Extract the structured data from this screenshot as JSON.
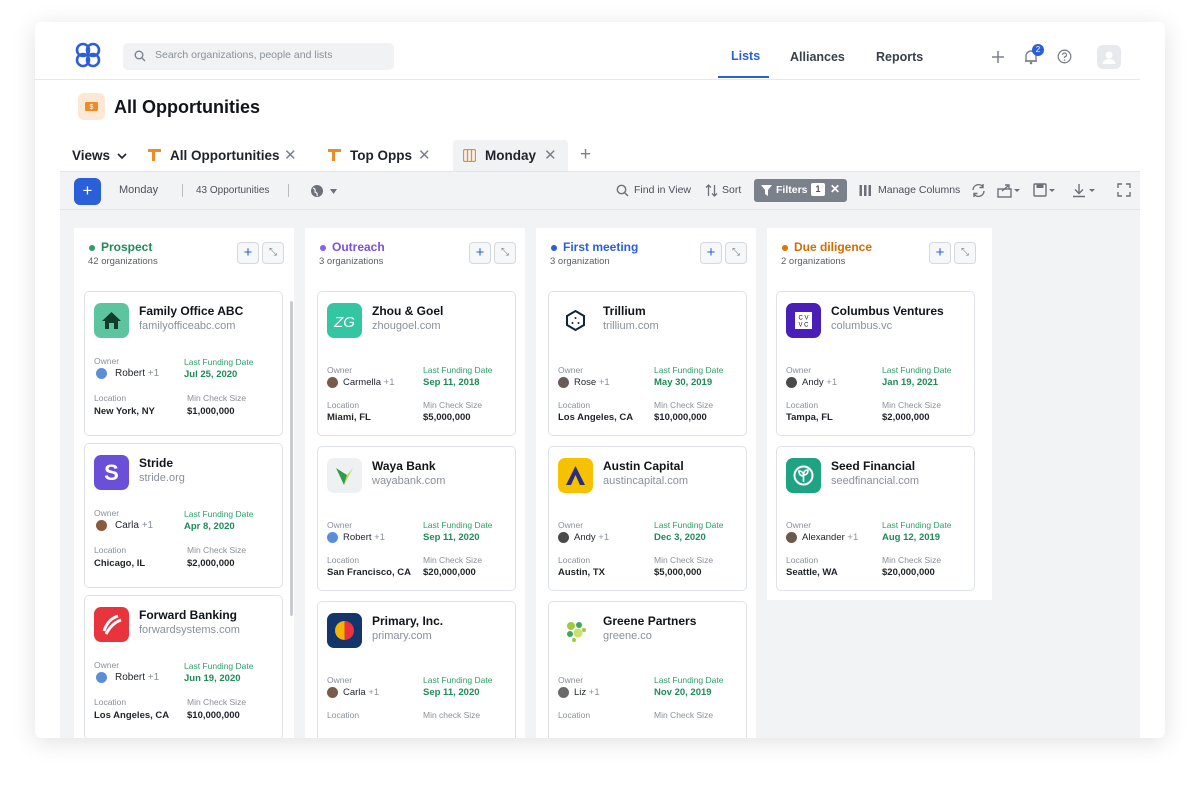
{
  "search": {
    "placeholder": "Search organizations, people and lists"
  },
  "nav": {
    "tabs": [
      "Lists",
      "Alliances",
      "Reports"
    ],
    "notification_count": "2"
  },
  "page": {
    "title": "All Opportunities"
  },
  "views": {
    "label": "Views",
    "tabs": [
      "All Opportunities",
      "Top Opps",
      "Monday"
    ]
  },
  "toolbar": {
    "view_name": "Monday",
    "count": "43 Opportunities",
    "find": "Find in View",
    "sort": "Sort",
    "filters": "Filters",
    "filters_count": "1",
    "manage": "Manage Columns"
  },
  "labels": {
    "owner": "Owner",
    "last_funding": "Last Funding Date",
    "location": "Location",
    "min_check": "Min Check Size",
    "min_check_lower": "Min check Size"
  },
  "colors": {
    "prospect": "#2e9e6a",
    "outreach": "#8b5cf6",
    "first_meeting": "#2b5fd9",
    "due_diligence": "#e07400"
  },
  "columns": [
    {
      "name": "Prospect",
      "count": "42 organizations",
      "cards": [
        {
          "name": "Family Office ABC",
          "domain": "familyofficeabc.com",
          "owner": "Robert",
          "more": "+1",
          "date": "Jul 25, 2020",
          "location": "New York, NY",
          "check": "$1,000,000",
          "icon": "home-icon"
        },
        {
          "name": "Stride",
          "domain": "stride.org",
          "owner": "Carla",
          "more": "+1",
          "date": "Apr 8, 2020",
          "location": "Chicago, IL",
          "check": "$2,000,000",
          "icon": "stride-logo"
        },
        {
          "name": "Forward Banking",
          "domain": "forwardsystems.com",
          "owner": "Robert",
          "more": "+1",
          "date": "Jun 19, 2020",
          "location": "Los Angeles, CA",
          "check": "$10,000,000",
          "icon": "forward-logo"
        }
      ]
    },
    {
      "name": "Outreach",
      "count": "3 organizations",
      "cards": [
        {
          "name": "Zhou & Goel",
          "domain": "zhougoel.com",
          "owner": "Carmella",
          "more": "+1",
          "date": "Sep 11, 2018",
          "location": "Miami, FL",
          "check": "$5,000,000",
          "icon": "zg-logo"
        },
        {
          "name": "Waya Bank",
          "domain": "wayabank.com",
          "owner": "Robert",
          "more": "+1",
          "date": "Sep 11, 2020",
          "location": "San Francisco, CA",
          "check": "$20,000,000",
          "icon": "waya-logo"
        },
        {
          "name": "Primary, Inc.",
          "domain": "primary.com",
          "owner": "Carla",
          "more": "+1",
          "date": "Sep 11, 2020",
          "location": "",
          "check": "",
          "icon": "primary-logo"
        }
      ]
    },
    {
      "name": "First meeting",
      "count": "3 organization",
      "cards": [
        {
          "name": "Trillium",
          "domain": "trillium.com",
          "owner": "Rose",
          "more": "+1",
          "date": "May 30, 2019",
          "location": "Los Angeles, CA",
          "check": "$10,000,000",
          "icon": "trillium-logo"
        },
        {
          "name": "Austin Capital",
          "domain": "austincapital.com",
          "owner": "Andy",
          "more": "+1",
          "date": "Dec 3, 2020",
          "location": "Austin, TX",
          "check": "$5,000,000",
          "icon": "austin-logo"
        },
        {
          "name": "Greene Partners",
          "domain": "greene.co",
          "owner": "Liz",
          "more": "+1",
          "date": "Nov 20, 2019",
          "location": "",
          "check": "",
          "icon": "greene-logo"
        }
      ]
    },
    {
      "name": "Due diligence",
      "count": "2 organizations",
      "cards": [
        {
          "name": "Columbus Ventures",
          "domain": "columbus.vc",
          "owner": "Andy",
          "more": "+1",
          "date": "Jan 19, 2021",
          "location": "Tampa, FL",
          "check": "$2,000,000",
          "icon": "cvvc-logo"
        },
        {
          "name": "Seed Financial",
          "domain": "seedfinancial.com",
          "owner": "Alexander",
          "more": "+1",
          "date": "Aug 12, 2019",
          "location": "Seattle, WA",
          "check": "$20,000,000",
          "icon": "seed-logo"
        }
      ]
    }
  ]
}
